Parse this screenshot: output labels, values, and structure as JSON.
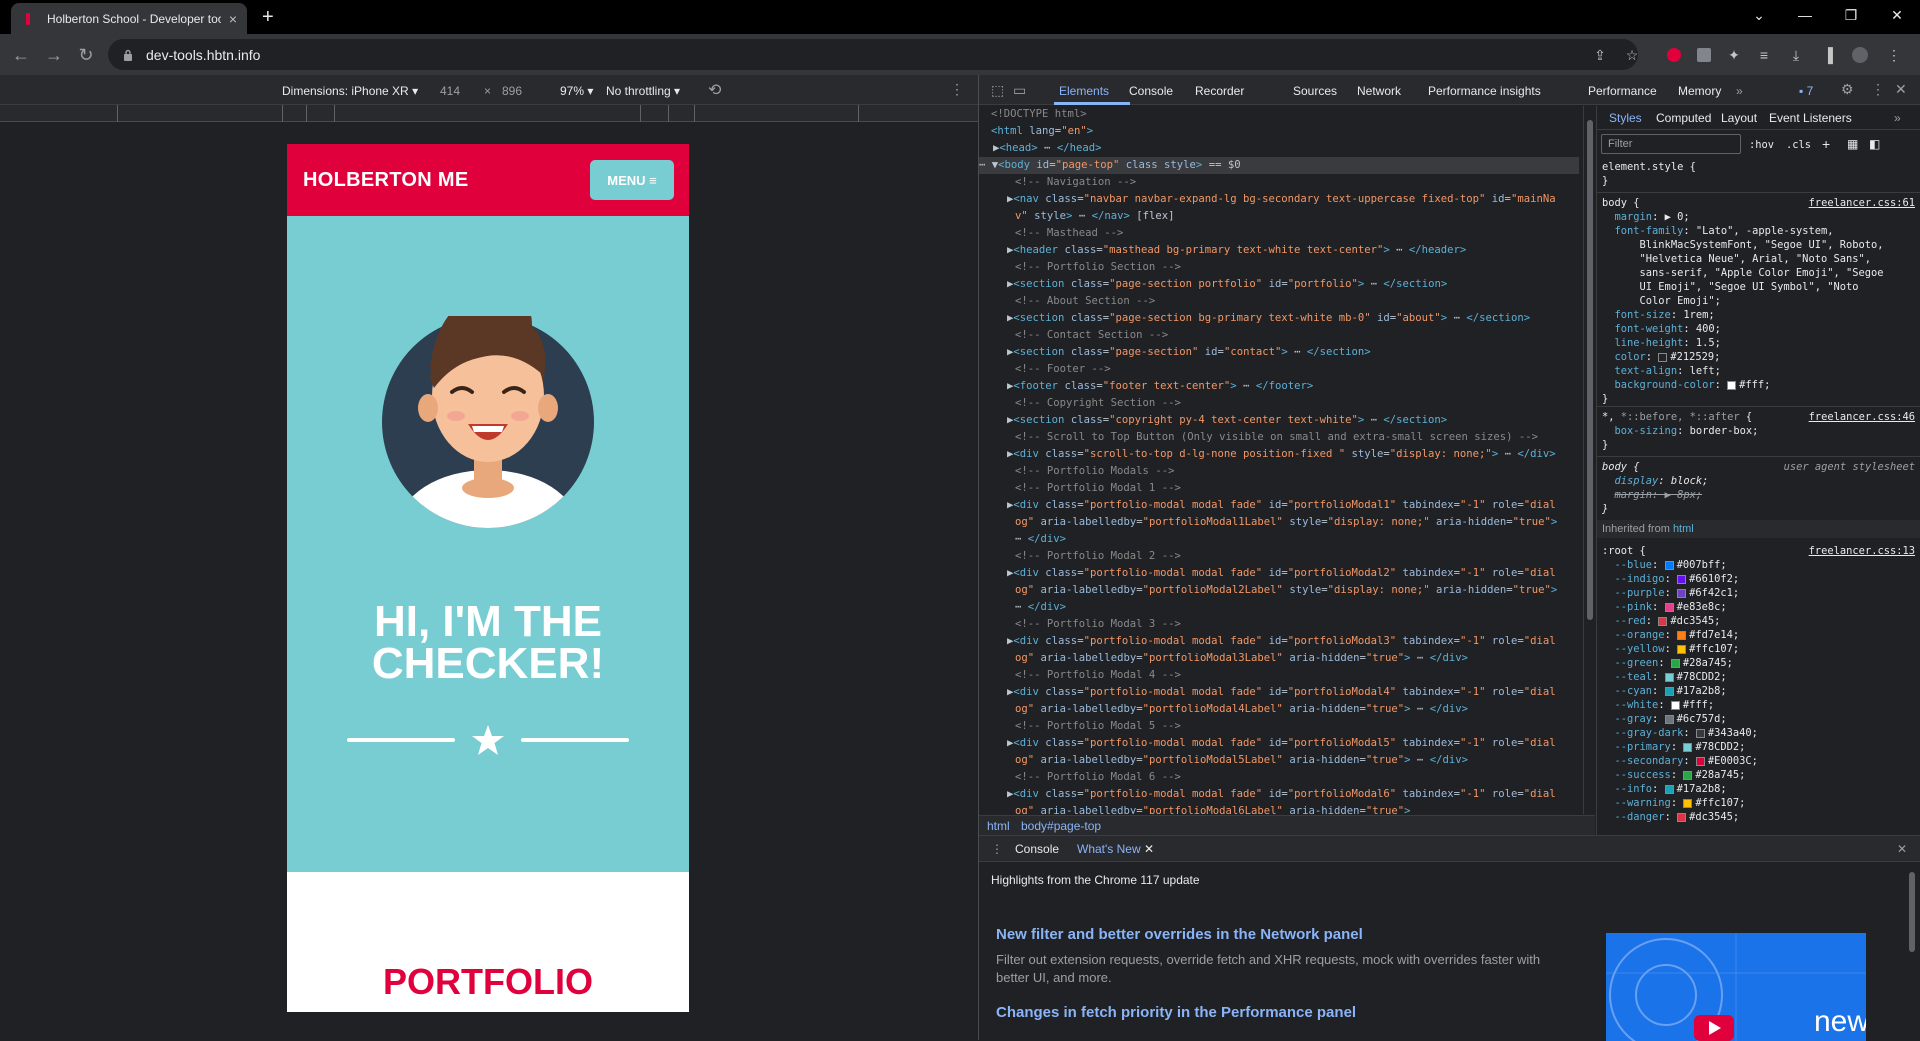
{
  "browser": {
    "tab_title": "Holberton School - Developer tools",
    "tab_close": "×",
    "new_tab": "+",
    "url": "dev-tools.hbtn.info"
  },
  "device_toolbar": {
    "dimensions_label": "Dimensions: iPhone XR",
    "width": "414",
    "times": "×",
    "height": "896",
    "zoom": "97%",
    "throttling": "No throttling"
  },
  "page": {
    "brand": "HOLBERTON ME",
    "menu_label": "MENU ≡",
    "hero_line1": "HI, I'M THE",
    "hero_line2": "CHECKER!",
    "portfolio_heading": "PORTFOLIO",
    "colors": {
      "primary": "#78CDD2",
      "secondary": "#E0003C"
    }
  },
  "devtools": {
    "tabs": [
      "Elements",
      "Console",
      "Recorder",
      "Sources",
      "Network",
      "Performance insights",
      "Performance",
      "Memory"
    ],
    "issues_count": "7",
    "breadcrumb": [
      "html",
      "body#page-top"
    ],
    "styles_tabs": [
      "Styles",
      "Computed",
      "Layout",
      "Event Listeners"
    ],
    "filter_placeholder": "Filter",
    "hov": ":hov",
    "cls": ".cls",
    "element_style": "element.style {",
    "body_source": "freelancer.css:61",
    "star_source": "freelancer.css:46",
    "user_agent": "user agent stylesheet",
    "inherited_from": "Inherited from",
    "inherited_tag": "html",
    "root_source": "freelancer.css:13",
    "root_vars": [
      {
        "name": "--blue",
        "value": "#007bff",
        "color": "#007bff"
      },
      {
        "name": "--indigo",
        "value": "#6610f2",
        "color": "#6610f2"
      },
      {
        "name": "--purple",
        "value": "#6f42c1",
        "color": "#6f42c1"
      },
      {
        "name": "--pink",
        "value": "#e83e8c",
        "color": "#e83e8c"
      },
      {
        "name": "--red",
        "value": "#dc3545",
        "color": "#dc3545"
      },
      {
        "name": "--orange",
        "value": "#fd7e14",
        "color": "#fd7e14"
      },
      {
        "name": "--yellow",
        "value": "#ffc107",
        "color": "#ffc107"
      },
      {
        "name": "--green",
        "value": "#28a745",
        "color": "#28a745"
      },
      {
        "name": "--teal",
        "value": "#78CDD2",
        "color": "#78CDD2"
      },
      {
        "name": "--cyan",
        "value": "#17a2b8",
        "color": "#17a2b8"
      },
      {
        "name": "--white",
        "value": "#fff",
        "color": "#ffffff"
      },
      {
        "name": "--gray",
        "value": "#6c757d",
        "color": "#6c757d"
      },
      {
        "name": "--gray-dark",
        "value": "#343a40",
        "color": "#343a40"
      },
      {
        "name": "--primary",
        "value": "#78CDD2",
        "color": "#78CDD2"
      },
      {
        "name": "--secondary",
        "value": "#E0003C",
        "color": "#E0003C"
      },
      {
        "name": "--success",
        "value": "#28a745",
        "color": "#28a745"
      },
      {
        "name": "--info",
        "value": "#17a2b8",
        "color": "#17a2b8"
      },
      {
        "name": "--warning",
        "value": "#ffc107",
        "color": "#ffc107"
      },
      {
        "name": "--danger",
        "value": "#dc3545",
        "color": "#dc3545"
      }
    ]
  },
  "drawer": {
    "tabs": [
      "Console",
      "What's New"
    ],
    "highlights": "Highlights from the Chrome 117 update",
    "item1_title": "New filter and better overrides in the Network panel",
    "item1_text": "Filter out extension requests, override fetch and XHR requests, mock with overrides faster with better UI, and more.",
    "item2_title": "Changes in fetch priority in the Performance panel",
    "video_label": "new"
  }
}
